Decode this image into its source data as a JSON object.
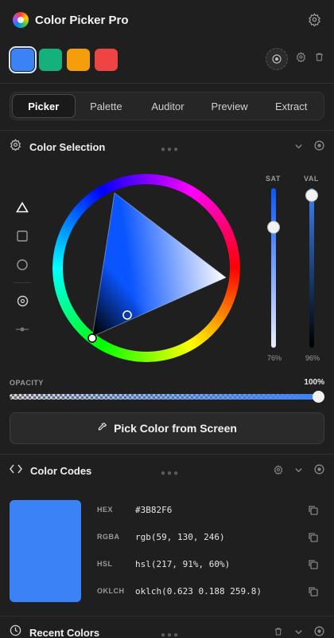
{
  "header": {
    "title": "Color Picker Pro"
  },
  "swatches": [
    {
      "color": "#3B82F6",
      "selected": true
    },
    {
      "color": "#16B07C",
      "selected": false
    },
    {
      "color": "#F59E0B",
      "selected": false
    },
    {
      "color": "#EF4444",
      "selected": false
    }
  ],
  "tabs": [
    {
      "label": "Picker",
      "active": true
    },
    {
      "label": "Palette",
      "active": false
    },
    {
      "label": "Auditor",
      "active": false
    },
    {
      "label": "Preview",
      "active": false
    },
    {
      "label": "Extract",
      "active": false
    }
  ],
  "color_selection": {
    "title": "Color Selection",
    "shapes": [
      "triangle-icon",
      "square-icon",
      "circle-icon"
    ],
    "tools": [
      "eyedropper-target-icon",
      "slider-handle-icon"
    ],
    "sat_label": "SAT",
    "val_label": "VAL",
    "sat_value": "76%",
    "val_value": "96%",
    "sat_fraction": 0.76,
    "val_fraction": 0.96,
    "hue_degrees": 217,
    "opacity_label": "OPACITY",
    "opacity_value": "100%",
    "opacity_fraction": 1.0,
    "pick_button_label": "Pick Color from Screen"
  },
  "color_codes": {
    "title": "Color Codes",
    "preview_color": "#3B82F6",
    "rows": [
      {
        "key": "HEX",
        "value": "#3B82F6"
      },
      {
        "key": "RGBA",
        "value": "rgb(59, 130, 246)"
      },
      {
        "key": "HSL",
        "value": "hsl(217, 91%, 60%)"
      },
      {
        "key": "OKLCH",
        "value": "oklch(0.623 0.188 259.8)"
      }
    ]
  },
  "recent_colors": {
    "title": "Recent Colors"
  }
}
